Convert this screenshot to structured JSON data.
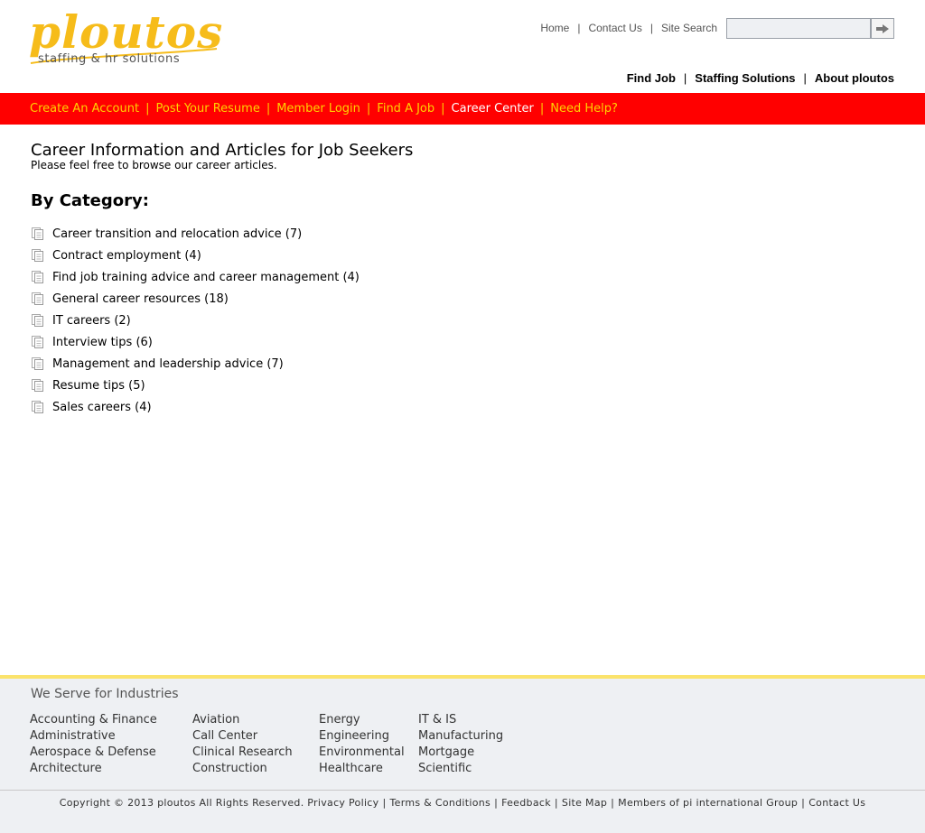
{
  "logo": {
    "brand": "ploutos",
    "tagline": "staffing & hr solutions"
  },
  "util_nav": {
    "home": "Home",
    "contact": "Contact Us",
    "site_search": "Site Search",
    "search_placeholder": ""
  },
  "main_nav": {
    "find_job": "Find Job",
    "staffing_solutions": "Staffing Solutions",
    "about": "About ploutos"
  },
  "redbar": {
    "items": [
      "Create An Account",
      "Post Your Resume",
      "Member Login",
      "Find A Job",
      "Career Center",
      "Need Help?"
    ],
    "active_index": 4
  },
  "content": {
    "title": "Career Information and Articles for Job Seekers",
    "subtitle": "Please feel free to browse our career articles.",
    "category_heading": "By Category:",
    "categories": [
      "Career transition and relocation advice (7)",
      "Contract employment (4)",
      "Find job training advice and career management (4)",
      "General career resources (18)",
      "IT careers (2)",
      "Interview tips (6)",
      "Management and leadership advice (7)",
      "Resume tips (5)",
      "Sales careers (4)"
    ]
  },
  "footer": {
    "title": "We Serve for Industries",
    "columns": [
      [
        "Accounting & Finance",
        "Administrative",
        "Aerospace & Defense",
        "Architecture"
      ],
      [
        "Aviation",
        "Call Center",
        "Clinical Research",
        "Construction"
      ],
      [
        "Energy",
        "Engineering",
        "Environmental",
        "Healthcare"
      ],
      [
        "IT & IS",
        "Manufacturing",
        "Mortgage",
        "Scientific"
      ]
    ]
  },
  "copyright": {
    "text": "Copyright © 2013 ploutos All Rights Reserved.",
    "links": [
      "Privacy Policy",
      "Terms & Conditions",
      "Feedback",
      "Site Map",
      "Members of pi international Group",
      "Contact Us"
    ]
  },
  "colors": {
    "accent_red": "#ff0000",
    "accent_yellow": "#ffd200",
    "logo_gold": "#f6bc1a",
    "footer_bg": "#eef0f3",
    "footer_line": "#fbe36b"
  }
}
